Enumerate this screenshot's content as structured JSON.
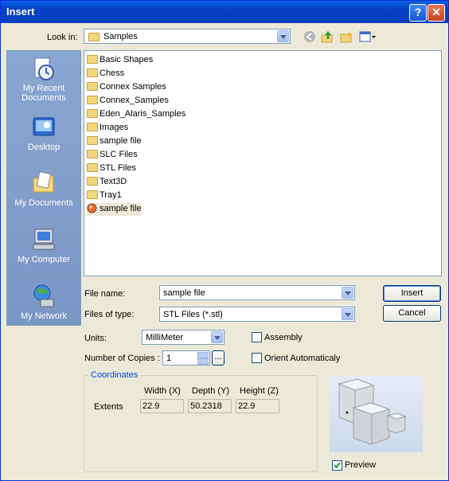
{
  "title": "Insert",
  "look_in": {
    "label": "Look in:",
    "value": "Samples"
  },
  "places": [
    {
      "label": "My Recent Documents",
      "icon": "recent-documents-icon"
    },
    {
      "label": "Desktop",
      "icon": "desktop-icon"
    },
    {
      "label": "My Documents",
      "icon": "my-documents-icon"
    },
    {
      "label": "My Computer",
      "icon": "my-computer-icon"
    },
    {
      "label": "My Network",
      "icon": "my-network-icon"
    }
  ],
  "files": [
    {
      "name": "Basic Shapes",
      "type": "folder"
    },
    {
      "name": "Chess",
      "type": "folder"
    },
    {
      "name": "Connex Samples",
      "type": "folder"
    },
    {
      "name": "Connex_Samples",
      "type": "folder"
    },
    {
      "name": "Eden_Alaris_Samples",
      "type": "folder"
    },
    {
      "name": "Images",
      "type": "folder"
    },
    {
      "name": "sample file",
      "type": "folder"
    },
    {
      "name": "SLC Files",
      "type": "folder"
    },
    {
      "name": "STL Files",
      "type": "folder"
    },
    {
      "name": "Text3D",
      "type": "folder"
    },
    {
      "name": "Tray1",
      "type": "folder"
    },
    {
      "name": "sample file",
      "type": "stl-file"
    }
  ],
  "file_name": {
    "label": "File name:",
    "value": "sample file"
  },
  "files_of_type": {
    "label": "Files of type:",
    "value": "STL Files (*.stl)"
  },
  "buttons": {
    "insert": "Insert",
    "cancel": "Cancel",
    "copies_more": "..."
  },
  "units": {
    "label": "Units:",
    "value": "MilliMeter"
  },
  "copies": {
    "label": "Number of Copies :",
    "value": "1"
  },
  "assembly": {
    "label": "Assembly",
    "checked": false
  },
  "orient": {
    "label": "Orient Automaticaly",
    "checked": false
  },
  "coordinates": {
    "title": "Coordinates",
    "width_label": "Width (X)",
    "depth_label": "Depth (Y)",
    "height_label": "Height (Z)",
    "extents_label": "Extents",
    "width": "22.9",
    "depth": "50.2318",
    "height": "22.9"
  },
  "preview": {
    "label": "Preview",
    "checked": true
  }
}
